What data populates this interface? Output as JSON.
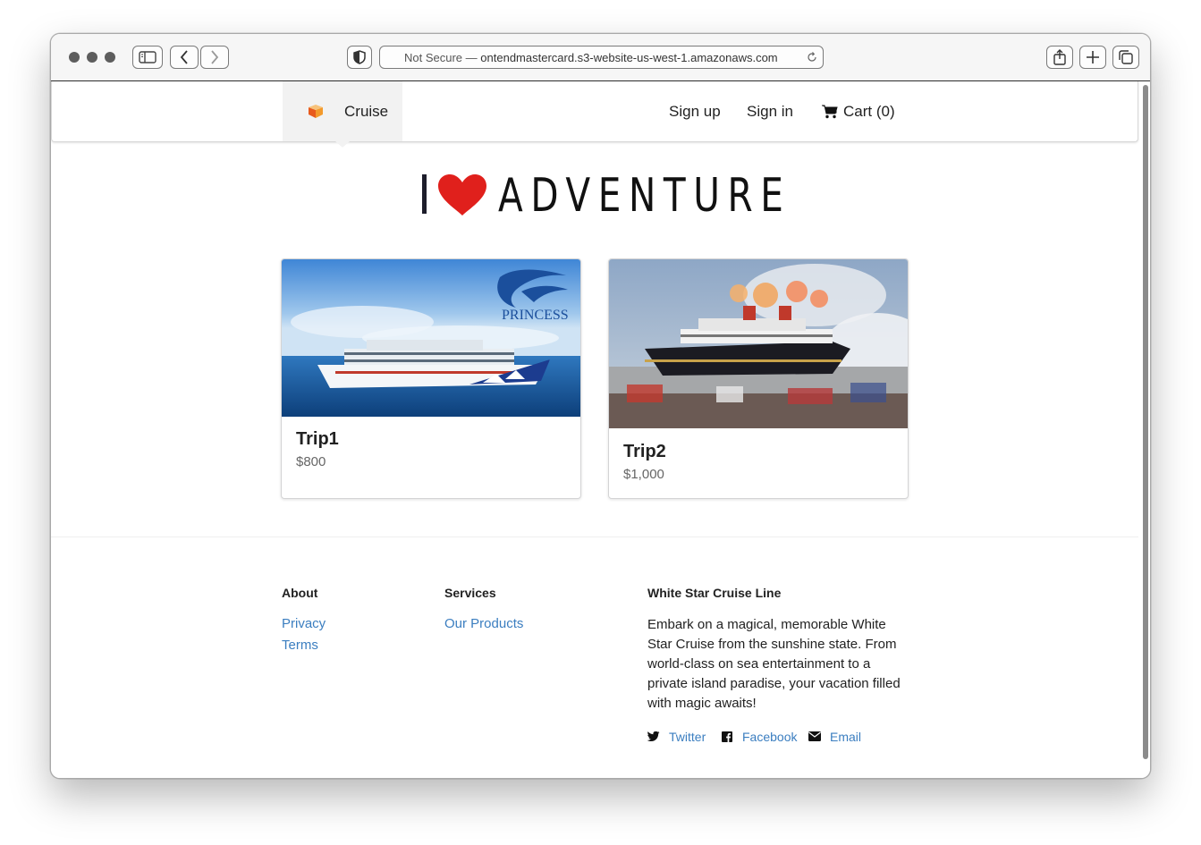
{
  "browser": {
    "address_prefix": "Not Secure —",
    "address_url": "ontendmastercard.s3-website-us-west-1.amazonaws.com"
  },
  "nav": {
    "brand": "Cruise",
    "sign_up": "Sign up",
    "sign_in": "Sign in",
    "cart": "Cart (0)"
  },
  "hero": {
    "prefix": "I",
    "heart": "heart-icon",
    "word": "ADVENTURE"
  },
  "trips": [
    {
      "title": "Trip1",
      "price": "$800",
      "image_logo": "PRINCESS"
    },
    {
      "title": "Trip2",
      "price": "$1,000"
    }
  ],
  "footer": {
    "about_heading": "About",
    "about_links": [
      "Privacy",
      "Terms"
    ],
    "services_heading": "Services",
    "services_links": [
      "Our Products"
    ],
    "company_heading": "White Star Cruise Line",
    "company_description": "Embark on a magical, memorable White Star Cruise from the sunshine state. From world-class on sea entertainment to a private island paradise, your vacation filled with magic awaits!",
    "social": [
      "Twitter",
      "Facebook",
      "Email"
    ]
  },
  "colors": {
    "link": "#3b7ec0",
    "heart": "#e0201c",
    "brand_bg": "#f2f2f2"
  }
}
